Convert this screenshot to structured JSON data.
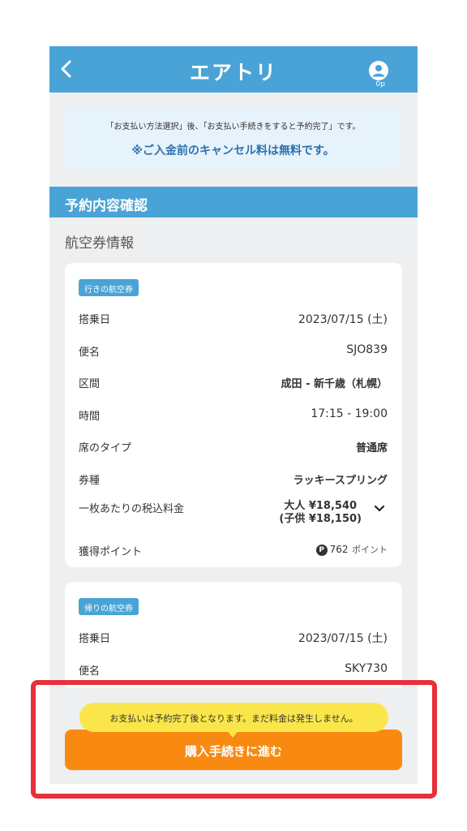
{
  "header": {
    "logo": "エアトリ",
    "points": "0p",
    "back_icon": "chevron-left-icon",
    "user_icon": "user-circle-icon"
  },
  "notice": {
    "text": "「お支払い方法選択」後、「お支払い手続きをすると予約完了」です。",
    "free_cancel": "※ご入金前のキャンセル料は無料です。"
  },
  "section": {
    "title": "予約内容確認",
    "subtitle": "航空券情報"
  },
  "outbound": {
    "tag": "行きの航空券",
    "rows": [
      {
        "label": "搭乗日",
        "value": "2023/07/15 (土)"
      },
      {
        "label": "便名",
        "value": "SJO839"
      },
      {
        "label": "区間",
        "value": "成田 - 新千歳（札幌）"
      },
      {
        "label": "時間",
        "value": "17:15 - 19:00"
      },
      {
        "label": "席のタイプ",
        "value": "普通席"
      },
      {
        "label": "券種",
        "value": "ラッキースプリング"
      }
    ],
    "fare": {
      "label": "一枚あたりの税込料金",
      "adult": "大人 ¥18,540",
      "child": "(子供 ¥18,150)"
    },
    "points": {
      "label": "獲得ポイント",
      "icon": "P",
      "value": "762",
      "unit": "ポイント"
    }
  },
  "return": {
    "tag": "帰りの航空券",
    "rows": [
      {
        "label": "搭乗日",
        "value": "2023/07/15 (土)"
      },
      {
        "label": "便名",
        "value": "SKY730"
      }
    ]
  },
  "footer": {
    "bubble": "お支払いは予約完了後となります。まだ料金は発生しません。",
    "cta": "購入手続きに進む"
  },
  "colors": {
    "primary": "#4aa3d6",
    "cta": "#f88a12",
    "bubble": "#fae64a",
    "highlight": "#e8303a"
  }
}
